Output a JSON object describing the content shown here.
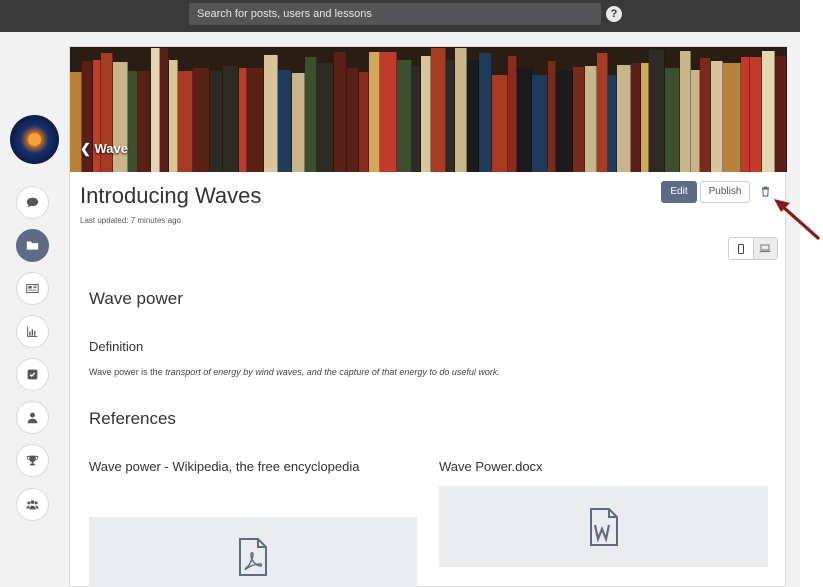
{
  "topbar": {
    "search_placeholder": "Search for posts, users and lessons",
    "help_label": "?"
  },
  "sidebar": {
    "items": [
      {
        "name": "comments",
        "icon": "comment-icon",
        "active": false
      },
      {
        "name": "folders",
        "icon": "folder-icon",
        "active": true
      },
      {
        "name": "newspaper",
        "icon": "newspaper-icon",
        "active": false
      },
      {
        "name": "stats",
        "icon": "bar-chart-icon",
        "active": false
      },
      {
        "name": "tasks",
        "icon": "check-square-icon",
        "active": false
      },
      {
        "name": "profile",
        "icon": "user-icon",
        "active": false
      },
      {
        "name": "achievements",
        "icon": "trophy-icon",
        "active": false
      },
      {
        "name": "groups",
        "icon": "users-icon",
        "active": false
      }
    ]
  },
  "lesson": {
    "back_label": "Wave",
    "title": "Introducing Waves",
    "updated": "Last updated: 7 minutes ago",
    "edit_label": "Edit",
    "publish_label": "Publish"
  },
  "content": {
    "section1_title": "Wave power",
    "definition_title": "Definition",
    "definition_prefix": "Wave power is the ",
    "definition_italic": "transport of energy by wind waves, and the capture of that energy to do useful work.",
    "references_title": "References",
    "references": [
      {
        "title": "Wave power - Wikipedia, the free encyclopedia",
        "icon": "pdf-file-icon"
      },
      {
        "title": "Wave Power.docx",
        "icon": "word-file-icon"
      }
    ]
  },
  "colors": {
    "accent": "#5d6b86",
    "topbar": "#3a3a3a",
    "annotation_arrow": "#8b1a1a"
  }
}
